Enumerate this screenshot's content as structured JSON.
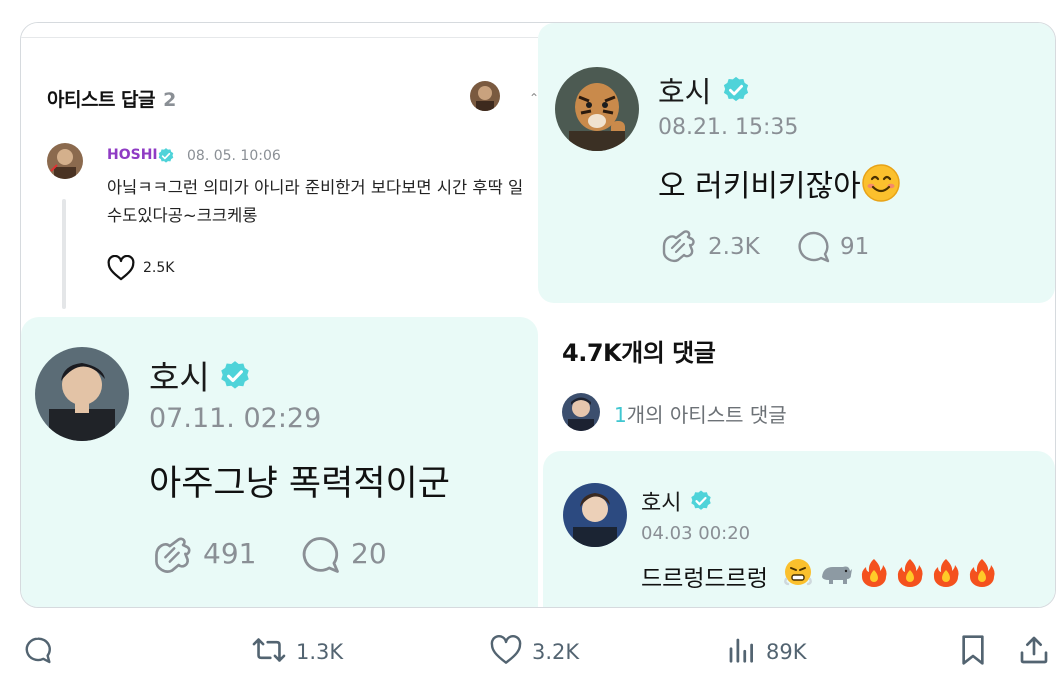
{
  "artist_replies": {
    "title": "아티스트 답글",
    "count": "2",
    "reply": {
      "author": "HOSHI",
      "time": "08. 05. 10:06",
      "text": "아닠ㅋㅋ그런 의미가 아니라 준비한거 보다보면 시간 후딱 일수도있다공~크크케롱",
      "likes": "2.5K"
    }
  },
  "post_tiger": {
    "author": "호시",
    "time": "08.21. 15:35",
    "text": "오 러키비키잖아",
    "reactions": "2.3K",
    "comments": "91"
  },
  "comments_panel": {
    "title": "4.7K개의 댓글",
    "artist_count": "1",
    "artist_suffix": "개의 아티스트 댓글"
  },
  "post_violent": {
    "author": "호시",
    "time": "07.11. 02:29",
    "text": "아주그냥 폭력적이군",
    "reactions": "491",
    "comments": "20"
  },
  "post_dreureung": {
    "author": "호시",
    "time": "04.03 00:20",
    "text": "드르렁드르렁",
    "emojis": [
      "steam-face",
      "rhino",
      "fire",
      "fire",
      "fire",
      "fire"
    ]
  },
  "actions": {
    "retweets": "1.3K",
    "likes": "3.2K",
    "views": "89K"
  },
  "colors": {
    "mint_bg": "#e9faf7",
    "verified": "#4fd3d9",
    "hoshi_purple": "#8f3bc4",
    "muted": "#8a8f95",
    "action_gray": "#536471"
  }
}
